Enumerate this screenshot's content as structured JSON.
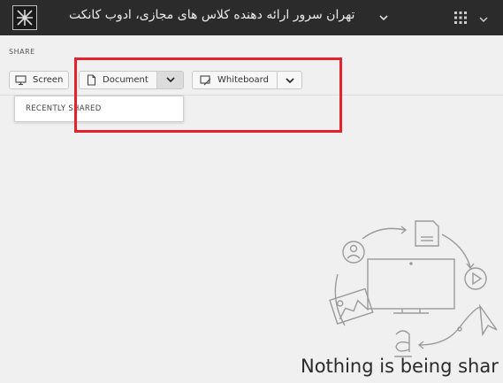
{
  "topbar": {
    "title": "تهران سرور ارائه دهنده کلاس های مجازی، ادوب کانکت",
    "logo_icon": "adobe-connect-logo-icon",
    "title_chevron_icon": "chevron-down-icon",
    "apps_icon": "apps-grid-icon",
    "apps_chevron_icon": "chevron-down-icon"
  },
  "share": {
    "section_label": "SHARE",
    "screen_label": "Screen",
    "document_label": "Document",
    "whiteboard_label": "Whiteboard",
    "dropdown": {
      "items": [
        "RECENTLY SHARED"
      ]
    }
  },
  "empty_state": {
    "message": "Nothing is being shar"
  },
  "colors": {
    "topbar_bg": "#2b2b2b",
    "page_bg": "#f0f0f0",
    "highlight": "#e5222c"
  }
}
